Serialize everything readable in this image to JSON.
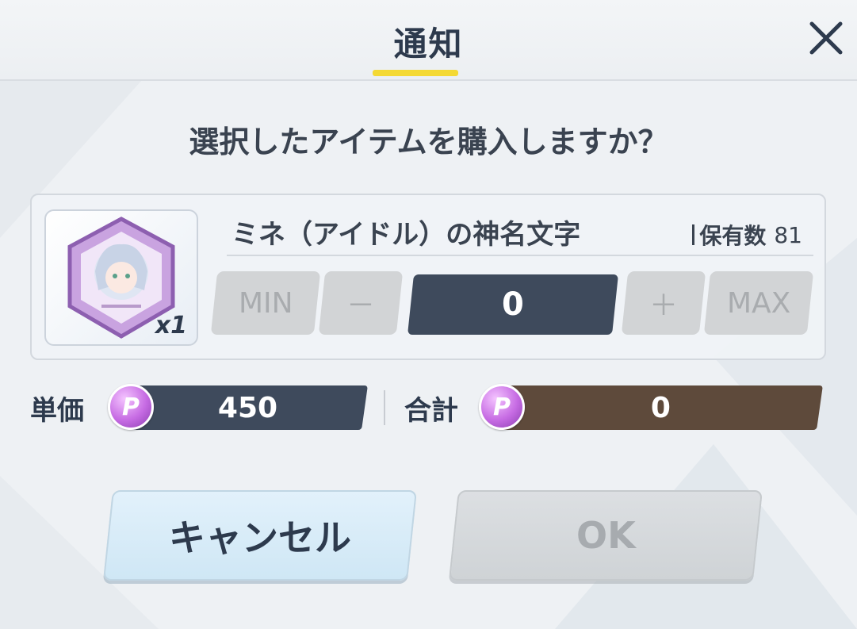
{
  "dialog": {
    "title": "通知",
    "close_icon": "close-icon",
    "question": "選択したアイテムを購入しますか？"
  },
  "item": {
    "name": "ミネ（アイドル）の神名文字",
    "quantity_badge": "x1",
    "owned_label": "保有数",
    "owned_count": "81"
  },
  "quantity": {
    "min_label": "MIN",
    "minus_label": "－",
    "value": "0",
    "plus_label": "＋",
    "max_label": "MAX"
  },
  "price": {
    "unit_label": "単価",
    "unit_value": "450",
    "total_label": "合計",
    "total_value": "0",
    "currency_symbol": "P"
  },
  "buttons": {
    "cancel_label": "キャンセル",
    "ok_label": "OK"
  },
  "colors": {
    "accent_yellow": "#f4d934",
    "field_navy": "#3e4a5c",
    "total_brown": "#5e4a3b",
    "cancel_blue": "#d6ecf8",
    "disabled_gray": "#d2d4d6"
  }
}
